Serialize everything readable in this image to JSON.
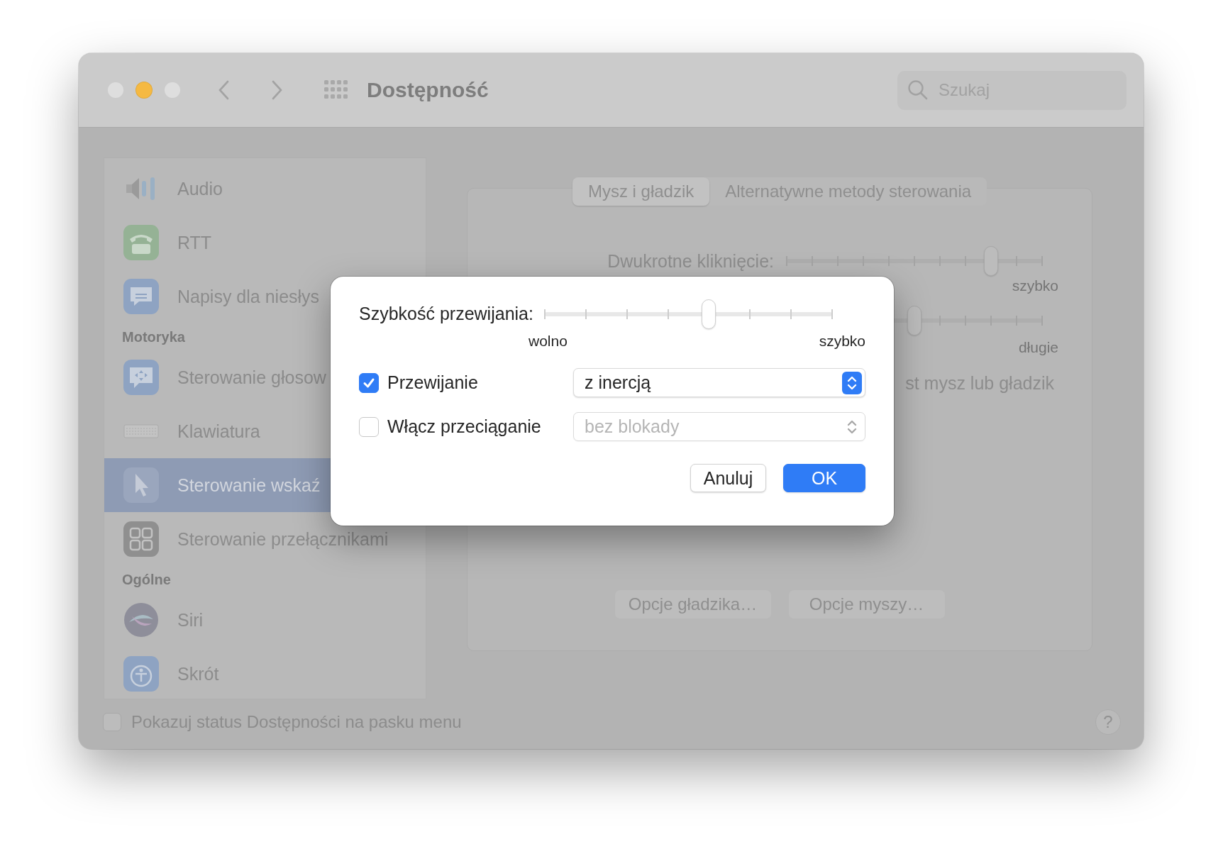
{
  "window": {
    "title": "Dostępność",
    "search": {
      "placeholder": "Szukaj"
    }
  },
  "sidebar": {
    "items": [
      {
        "kind": "item",
        "label": "Audio",
        "selected": false
      },
      {
        "kind": "item",
        "label": "RTT",
        "selected": false
      },
      {
        "kind": "item",
        "label": "Napisy dla niesłys",
        "selected": false
      },
      {
        "kind": "header",
        "label": "Motoryka"
      },
      {
        "kind": "item",
        "label": "Sterowanie głosow",
        "selected": false
      },
      {
        "kind": "item",
        "label": "Klawiatura",
        "selected": false
      },
      {
        "kind": "item",
        "label": "Sterowanie wskaź",
        "selected": true
      },
      {
        "kind": "item",
        "label": "Sterowanie przełącznikami",
        "selected": false
      },
      {
        "kind": "header",
        "label": "Ogólne"
      },
      {
        "kind": "item",
        "label": "Siri",
        "selected": false
      },
      {
        "kind": "item",
        "label": "Skrót",
        "selected": false
      }
    ]
  },
  "content": {
    "tabs": [
      {
        "label": "Mysz i gładzik",
        "selected": true
      },
      {
        "label": "Alternatywne metody sterowania",
        "selected": false
      }
    ],
    "double_click": {
      "label": "Dwukrotne kliknięcie:",
      "level": 0.8,
      "max_label": "szybko"
    },
    "slider_2": {
      "level": 0.5,
      "max_label": "długie"
    },
    "option_text": "st mysz lub gładzik",
    "buttons": [
      "Opcje gładzika…",
      "Opcje myszy…"
    ]
  },
  "footer": {
    "checkbox": {
      "label": "Pokazuj status Dostępności na pasku menu",
      "checked": false
    },
    "help": "?"
  },
  "dialog": {
    "scroll_speed": {
      "label": "Szybkość przewijania:",
      "level": 0.571,
      "min_label": "wolno",
      "max_label": "szybko"
    },
    "options": [
      {
        "label": "Przewijanie",
        "checked": true,
        "value": "z inercją",
        "disabled": false
      },
      {
        "label": "Włącz przeciąganie",
        "checked": false,
        "value": "bez blokady",
        "disabled": true
      }
    ],
    "buttons": [
      {
        "label": "Anuluj",
        "kind": "secondary"
      },
      {
        "label": "OK",
        "kind": "primary"
      }
    ]
  }
}
